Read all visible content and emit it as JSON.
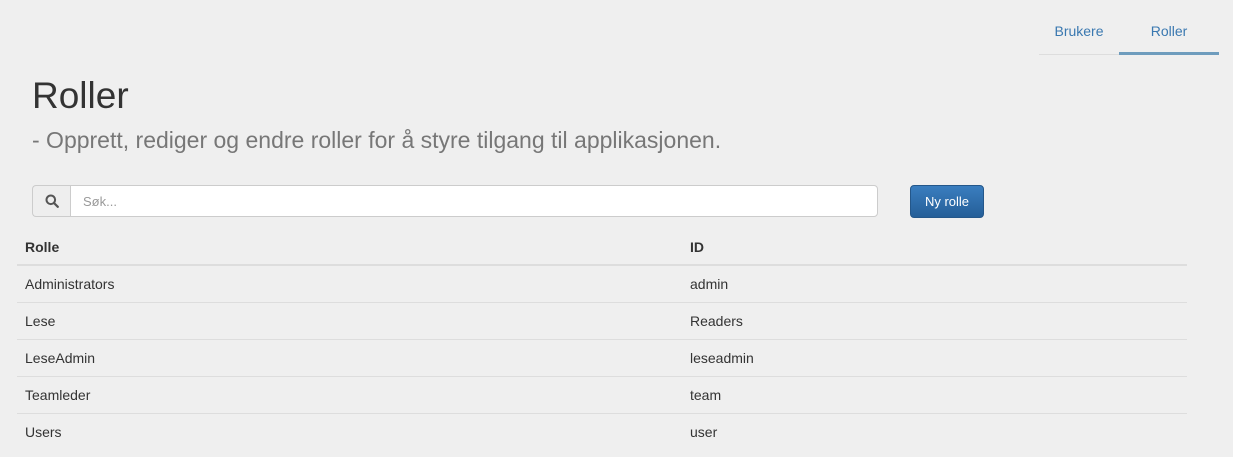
{
  "nav": {
    "tabs": [
      {
        "label": "Brukere"
      },
      {
        "label": "Roller"
      }
    ]
  },
  "header": {
    "title": "Roller",
    "subtitle": "- Opprett, rediger og endre roller for å styre tilgang til applikasjonen."
  },
  "search": {
    "placeholder": "Søk...",
    "value": "",
    "icon": "search-icon"
  },
  "toolbar": {
    "new_role_label": "Ny rolle"
  },
  "colors": {
    "accent": "#3a78b0",
    "primary_button": "#2d6aa3",
    "background": "#efefef"
  },
  "table": {
    "headers": [
      "Rolle",
      "ID"
    ],
    "rows": [
      [
        "Administrators",
        "admin"
      ],
      [
        "Lese",
        "Readers"
      ],
      [
        "LeseAdmin",
        "leseadmin"
      ],
      [
        "Teamleder",
        "team"
      ],
      [
        "Users",
        "user"
      ]
    ]
  }
}
